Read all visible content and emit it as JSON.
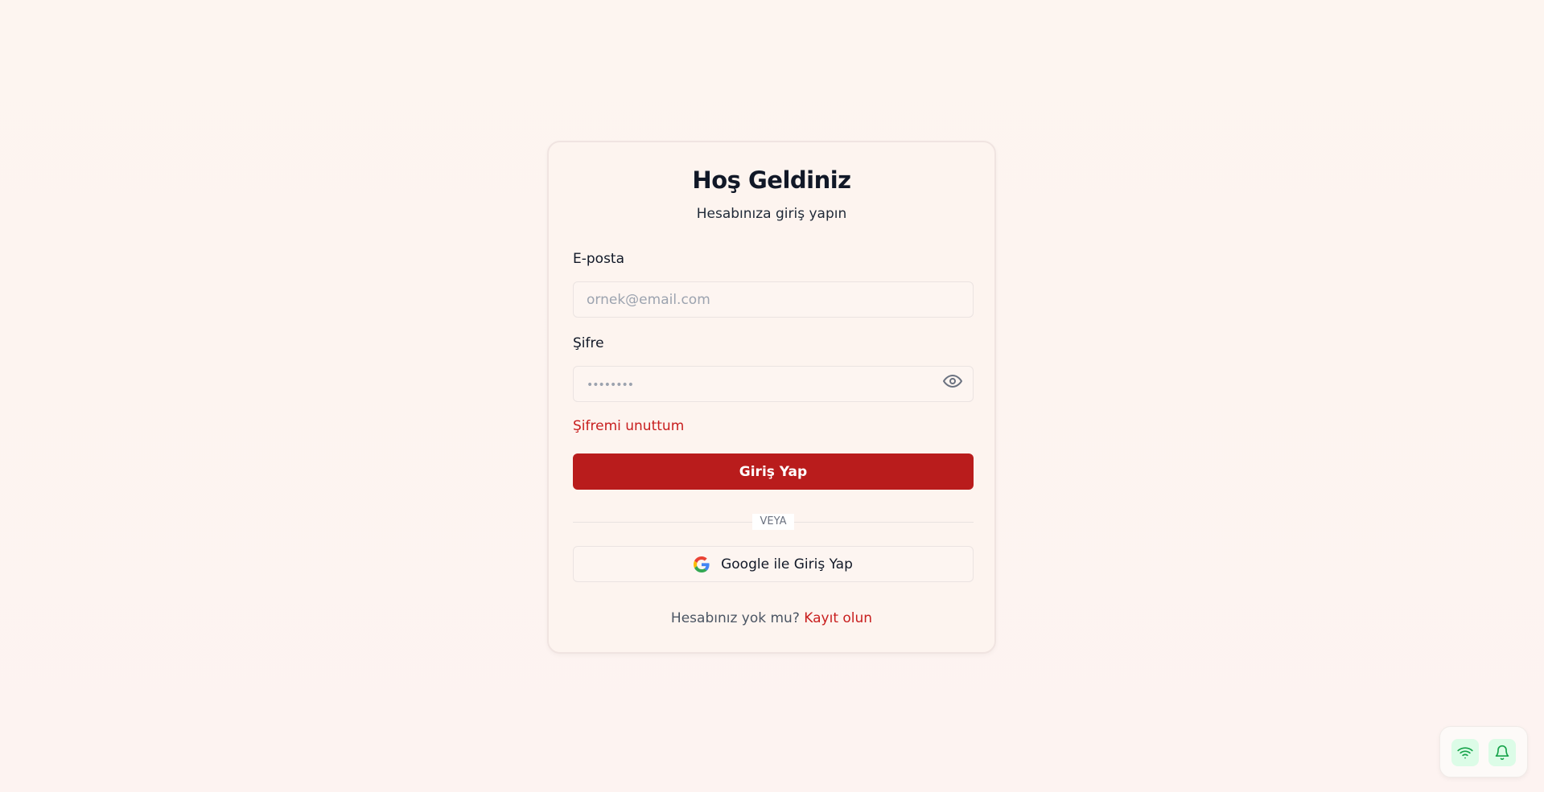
{
  "login": {
    "title": "Hoş Geldiniz",
    "subtitle": "Hesabınıza giriş yapın",
    "email_label": "E-posta",
    "email_placeholder": "ornek@email.com",
    "email_value": "",
    "password_label": "Şifre",
    "password_placeholder": "••••••••",
    "password_value": "",
    "forgot_link": "Şifremi unuttum",
    "submit_label": "Giriş Yap",
    "divider_text": "VEYA",
    "google_label": "Google ile Giriş Yap",
    "no_account_text": "Hesabınız yok mu?",
    "register_link": "Kayıt olun"
  },
  "status_widget": {
    "icons": [
      "wifi-icon",
      "bell-icon"
    ]
  },
  "colors": {
    "accent": "#b91c1c",
    "link": "#c81e1e",
    "status_green": "#16a34a",
    "status_bg": "#dcfce7"
  }
}
